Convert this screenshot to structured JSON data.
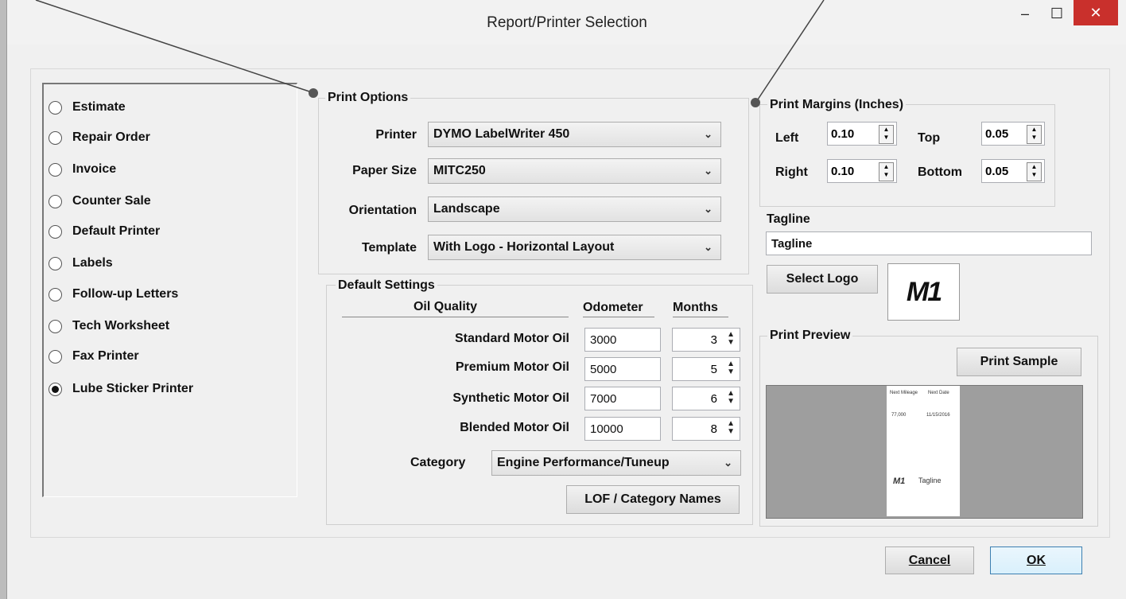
{
  "window": {
    "title": "Report/Printer Selection",
    "minimize": "–",
    "maximize": "☐",
    "close": "✕"
  },
  "report_types": [
    {
      "label": "Estimate",
      "selected": false
    },
    {
      "label": "Repair Order",
      "selected": false
    },
    {
      "label": "Invoice",
      "selected": false
    },
    {
      "label": "Counter Sale",
      "selected": false
    },
    {
      "label": "Default Printer",
      "selected": false
    },
    {
      "label": "Labels",
      "selected": false
    },
    {
      "label": "Follow-up Letters",
      "selected": false
    },
    {
      "label": "Tech Worksheet",
      "selected": false
    },
    {
      "label": "Fax Printer",
      "selected": false
    },
    {
      "label": "Lube Sticker Printer",
      "selected": true
    }
  ],
  "print_options": {
    "legend": "Print Options",
    "printer_label": "Printer",
    "printer_value": "DYMO LabelWriter 450",
    "paper_label": "Paper Size",
    "paper_value": "MITC250",
    "orientation_label": "Orientation",
    "orientation_value": "Landscape",
    "template_label": "Template",
    "template_value": "With Logo - Horizontal Layout"
  },
  "margins": {
    "legend": "Print Margins (Inches)",
    "left_label": "Left",
    "left_value": "0.10",
    "top_label": "Top",
    "top_value": "0.05",
    "right_label": "Right",
    "right_value": "0.10",
    "bottom_label": "Bottom",
    "bottom_value": "0.05"
  },
  "tagline": {
    "label": "Tagline",
    "value": "Tagline"
  },
  "logo": {
    "button": "Select Logo",
    "logo_text": "M1"
  },
  "defaults": {
    "legend": "Default Settings",
    "col_quality": "Oil Quality",
    "col_odometer": "Odometer",
    "col_months": "Months",
    "rows": [
      {
        "name": "Standard Motor Oil",
        "odometer": "3000",
        "months": "3"
      },
      {
        "name": "Premium Motor Oil",
        "odometer": "5000",
        "months": "5"
      },
      {
        "name": "Synthetic Motor Oil",
        "odometer": "7000",
        "months": "6"
      },
      {
        "name": "Blended Motor Oil",
        "odometer": "10000",
        "months": "8"
      }
    ],
    "category_label": "Category",
    "category_value": "Engine Performance/Tuneup",
    "lof_button": "LOF / Category Names"
  },
  "preview": {
    "legend": "Print Preview",
    "print_sample": "Print Sample",
    "label_col1": "Next Mileage",
    "label_col2": "Next Date",
    "label_val1": "77,000",
    "label_val2": "11/15/2016",
    "label_logo": "M1",
    "label_tagline": "Tagline"
  },
  "footer": {
    "cancel": "Cancel",
    "ok": "OK"
  }
}
